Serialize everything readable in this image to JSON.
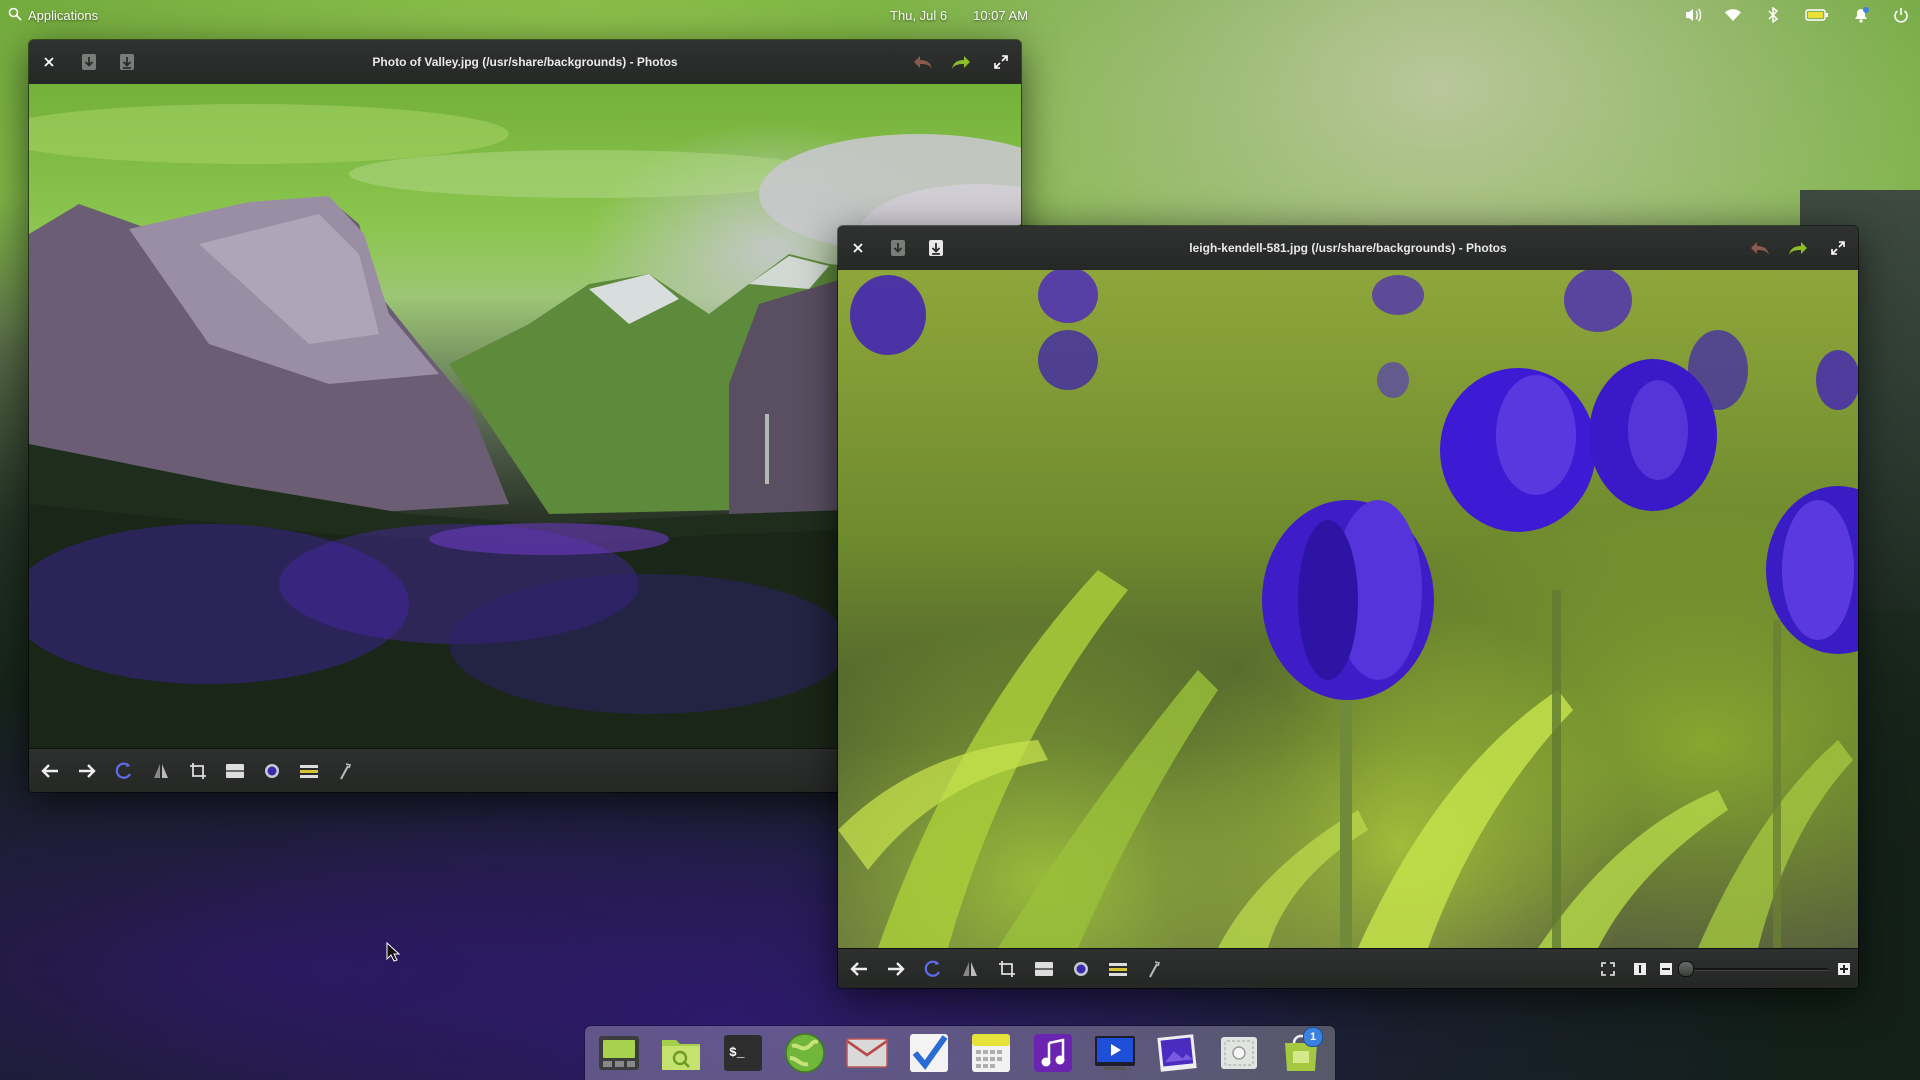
{
  "panel": {
    "applications_label": "Applications",
    "date": "Thu, Jul 6",
    "time": "10:07 AM"
  },
  "window_valley": {
    "title": "Photo of Valley.jpg (/usr/share/backgrounds) - Photos"
  },
  "window_tulips": {
    "title": "leigh-kendell-581.jpg (/usr/share/backgrounds) - Photos",
    "zoom_level": 0
  },
  "dock": {
    "items": [
      "multitasking-view",
      "files",
      "terminal",
      "web-browser",
      "mail",
      "tasks",
      "calendar",
      "music",
      "videos",
      "photos",
      "screenshot",
      "appcenter"
    ],
    "appcenter_badge": "1"
  },
  "colors": {
    "panel_text": "#ffffff",
    "accent_blue": "#3b82e0",
    "toolbar_icon": "#d8d8d8"
  }
}
